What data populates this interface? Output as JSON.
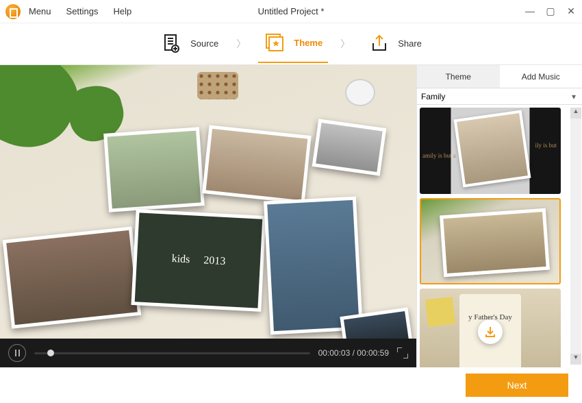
{
  "titlebar": {
    "menu_items": [
      "Menu",
      "Settings",
      "Help"
    ],
    "project_title": "Untitled Project *"
  },
  "steps": {
    "source": "Source",
    "theme": "Theme",
    "share": "Share"
  },
  "preview": {
    "p4_left": "kids",
    "p4_right": "2013"
  },
  "player": {
    "timecode": "00:00:03 / 00:00:59"
  },
  "sidepanel": {
    "tabs": {
      "theme": "Theme",
      "add_music": "Add Music"
    },
    "category_selected": "Family",
    "theme3_text": "y Father's Day"
  },
  "footer": {
    "next": "Next"
  },
  "colors": {
    "accent": "#f39c12"
  }
}
